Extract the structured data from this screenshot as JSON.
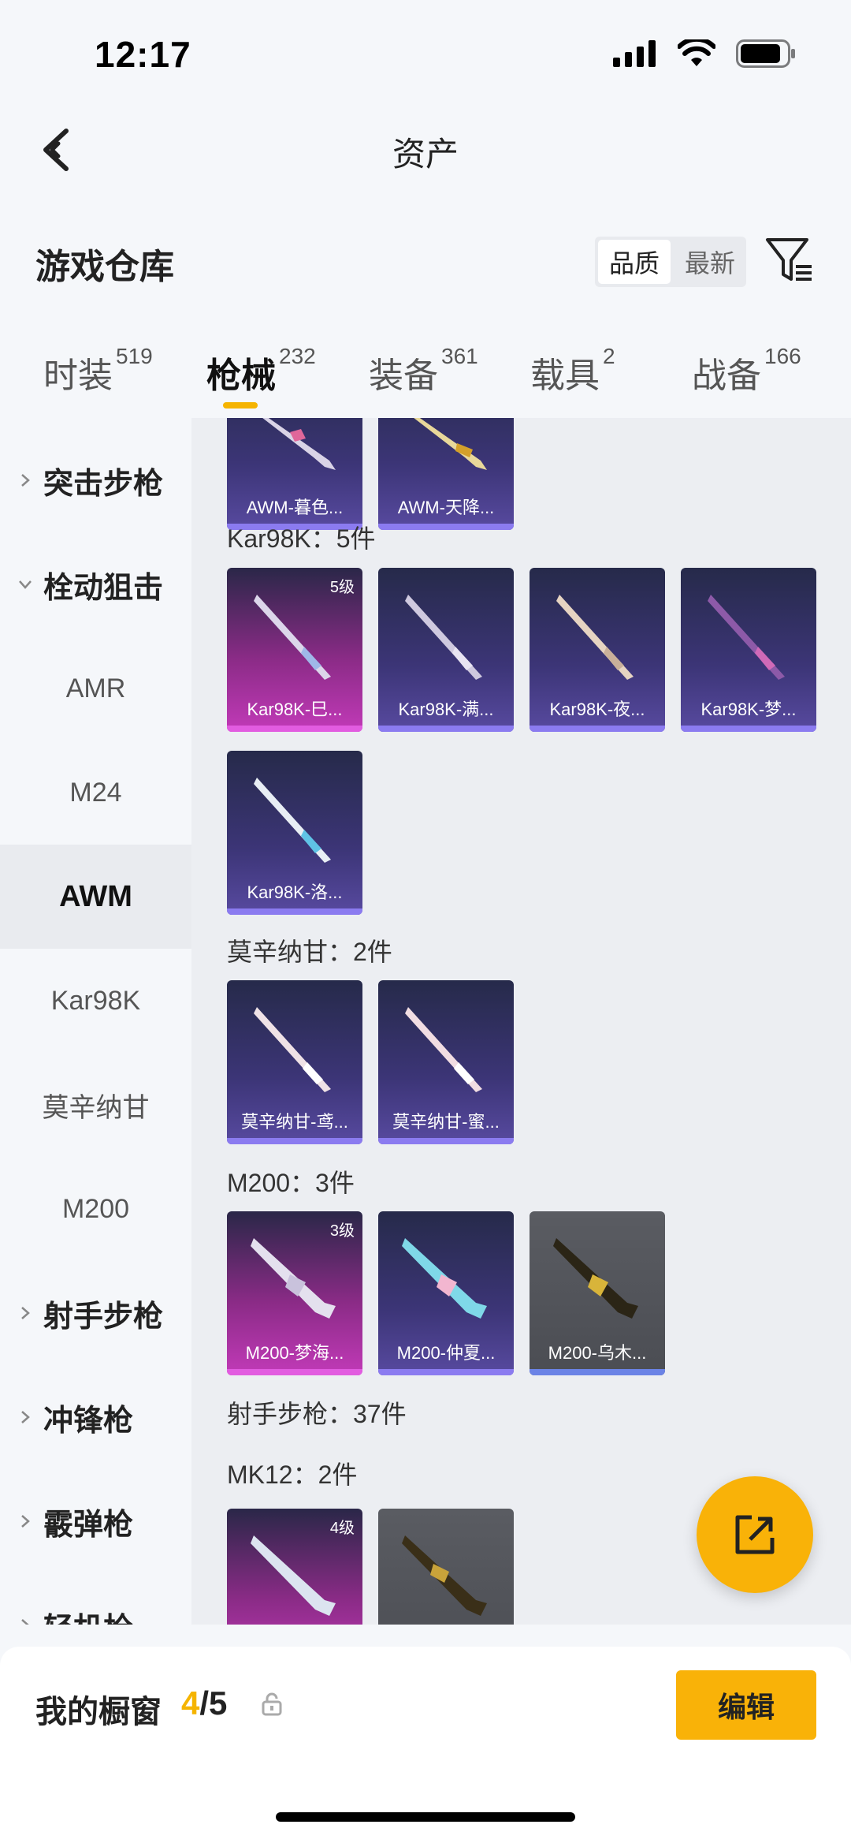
{
  "status": {
    "time": "12:17"
  },
  "nav": {
    "title": "资产"
  },
  "section": {
    "title": "游戏仓库",
    "sort_options": [
      "品质",
      "最新"
    ]
  },
  "tabs": [
    {
      "label": "时装",
      "count": "519"
    },
    {
      "label": "枪械",
      "count": "232"
    },
    {
      "label": "装备",
      "count": "361"
    },
    {
      "label": "载具",
      "count": "2"
    },
    {
      "label": "战备",
      "count": "166"
    }
  ],
  "sidebar": [
    {
      "label": "突击步枪"
    },
    {
      "label": "栓动狙击"
    },
    {
      "label": "AMR"
    },
    {
      "label": "M24"
    },
    {
      "label": "AWM"
    },
    {
      "label": "Kar98K"
    },
    {
      "label": "莫辛纳甘"
    },
    {
      "label": "M200"
    },
    {
      "label": "射手步枪"
    },
    {
      "label": "冲锋枪"
    },
    {
      "label": "霰弹枪"
    },
    {
      "label": "轻机枪"
    }
  ],
  "groups": {
    "awm": {
      "items": [
        {
          "name": "AWM-暮色..."
        },
        {
          "name": "AWM-天降..."
        }
      ]
    },
    "kar98k": {
      "label": "Kar98K：5件",
      "items": [
        {
          "name": "Kar98K-巳...",
          "level": "5级"
        },
        {
          "name": "Kar98K-满..."
        },
        {
          "name": "Kar98K-夜..."
        },
        {
          "name": "Kar98K-梦..."
        },
        {
          "name": "Kar98K-洛..."
        }
      ]
    },
    "mosin": {
      "label": "莫辛纳甘：2件",
      "items": [
        {
          "name": "莫辛纳甘-鸢..."
        },
        {
          "name": "莫辛纳甘-蜜..."
        }
      ]
    },
    "m200": {
      "label": "M200：3件",
      "items": [
        {
          "name": "M200-梦海...",
          "level": "3级"
        },
        {
          "name": "M200-仲夏..."
        },
        {
          "name": "M200-乌木..."
        }
      ]
    },
    "marksman": {
      "label": "射手步枪：37件"
    },
    "mk12": {
      "label": "MK12：2件",
      "items": [
        {
          "level": "4级"
        },
        {}
      ]
    }
  },
  "bottom": {
    "window_label": "我的橱窗",
    "count_current": "4",
    "count_total": "/5",
    "edit_label": "编辑"
  },
  "colors": {
    "accent": "#f9b208",
    "purple_card": "#3c3577",
    "pink_card": "#c23ab8",
    "grey_card": "#4b4d53"
  }
}
